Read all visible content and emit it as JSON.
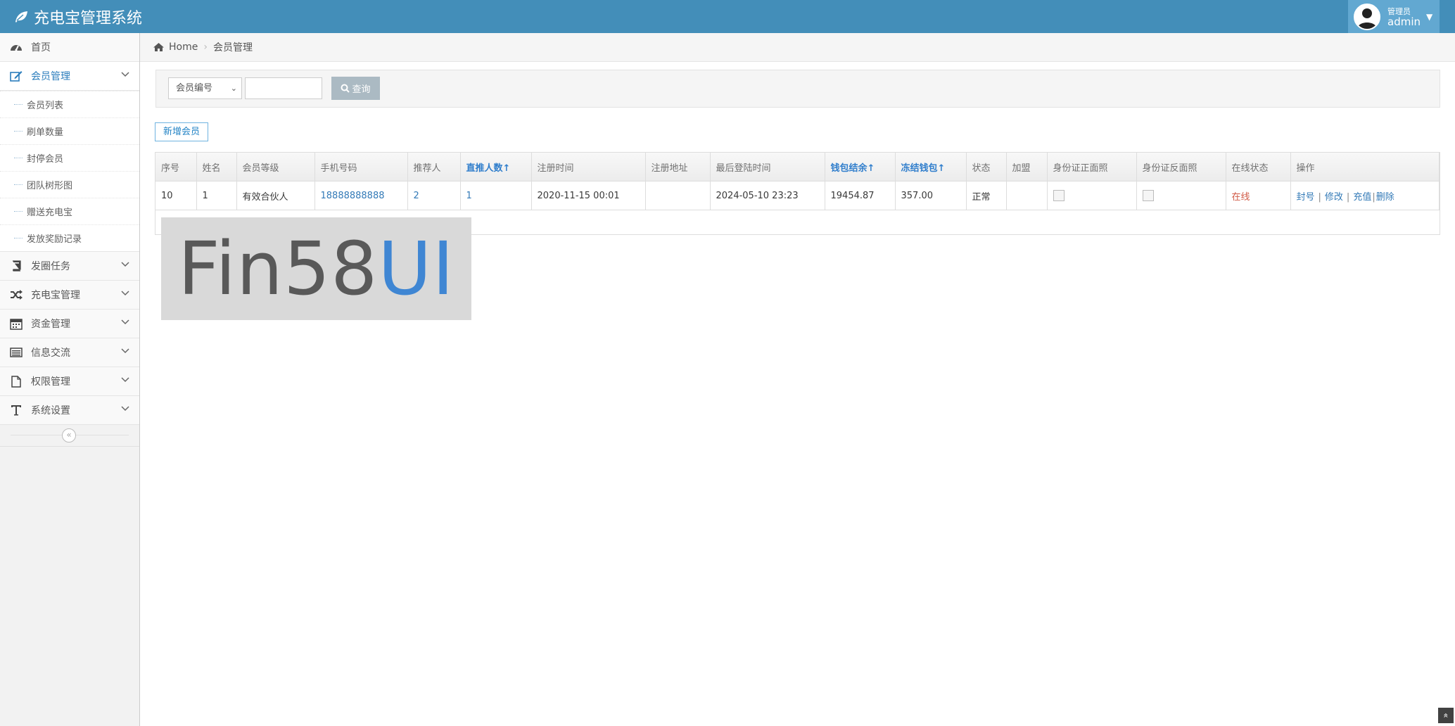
{
  "app": {
    "title": "充电宝管理系统"
  },
  "user": {
    "role": "管理员",
    "name": "admin"
  },
  "breadcrumb": {
    "home": "Home",
    "current": "会员管理"
  },
  "sidebar": {
    "items": [
      {
        "label": "首页",
        "icon": "tachometer-icon"
      },
      {
        "label": "会员管理",
        "icon": "edit-icon"
      },
      {
        "label": "发圈任务",
        "icon": "book-icon"
      },
      {
        "label": "充电宝管理",
        "icon": "random-icon"
      },
      {
        "label": "资金管理",
        "icon": "calendar-icon"
      },
      {
        "label": "信息交流",
        "icon": "list-icon"
      },
      {
        "label": "权限管理",
        "icon": "file-icon"
      },
      {
        "label": "系统设置",
        "icon": "text-icon"
      }
    ],
    "submenu": [
      "会员列表",
      "刷单数量",
      "封停会员",
      "团队树形图",
      "赠送充电宝",
      "发放奖励记录"
    ],
    "collapse_label": "«"
  },
  "search": {
    "field_selected": "会员编号",
    "query_value": "",
    "button_label": "查询"
  },
  "actions": {
    "add_member": "新增会员"
  },
  "table": {
    "headers": [
      "序号",
      "姓名",
      "会员等级",
      "手机号码",
      "推荐人",
      "直推人数↑",
      "注册时间",
      "注册地址",
      "最后登陆时间",
      "钱包结余↑",
      "冻结钱包↑",
      "状态",
      "加盟",
      "身份证正面照",
      "身份证反面照",
      "在线状态",
      "操作"
    ],
    "rows": [
      {
        "id": "10",
        "name": "1",
        "level": "有效合伙人",
        "phone": "18888888888",
        "referrer": "2",
        "direct_count": "1",
        "reg_time": "2020-11-15 00:01",
        "reg_addr": "",
        "last_login": "2024-05-10 23:23",
        "wallet": "19454.87",
        "frozen": "357.00",
        "status": "正常",
        "join": "",
        "online": "在线",
        "ops": [
          "封号",
          "修改",
          "充值",
          "删除"
        ]
      }
    ]
  },
  "watermark": {
    "text_a": "Fin58",
    "text_b": "UI"
  },
  "scroll_top_label": "»",
  "colors": {
    "navbar": "#438eb9",
    "link": "#337ab7",
    "online": "#d15b47"
  }
}
